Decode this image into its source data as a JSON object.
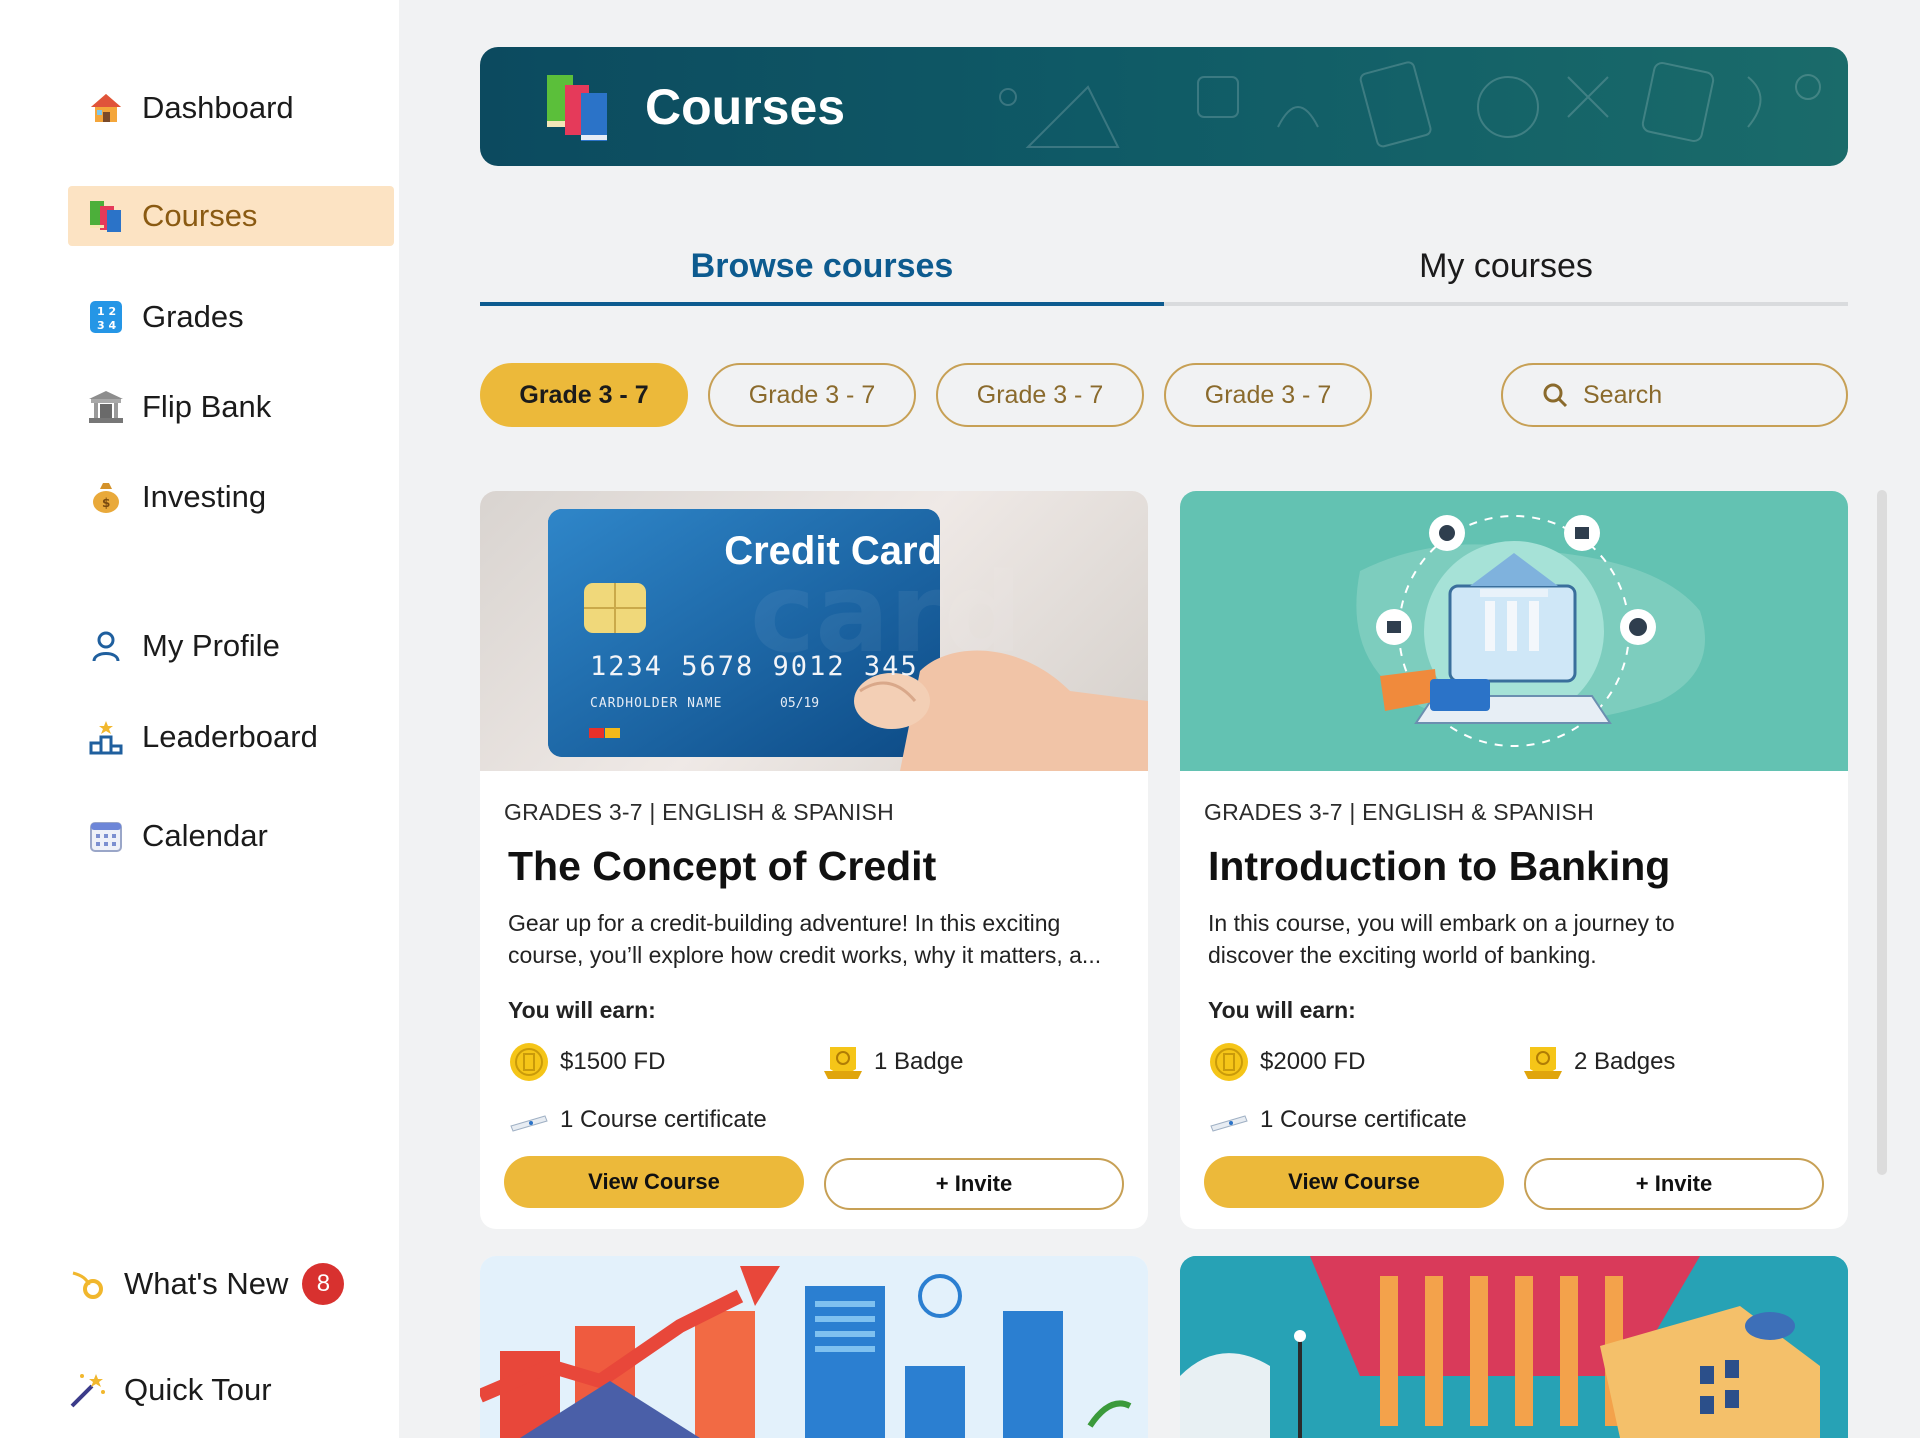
{
  "sidebar": {
    "items": [
      {
        "label": "Dashboard",
        "icon": "house-icon"
      },
      {
        "label": "Courses",
        "icon": "books-icon"
      },
      {
        "label": "Grades",
        "icon": "numbers-icon"
      },
      {
        "label": "Flip Bank",
        "icon": "bank-icon"
      },
      {
        "label": "Investing",
        "icon": "money-bag-icon"
      },
      {
        "label": "My Profile",
        "icon": "person-icon"
      },
      {
        "label": "Leaderboard",
        "icon": "podium-icon"
      },
      {
        "label": "Calendar",
        "icon": "calendar-icon"
      }
    ],
    "whats_new": {
      "label": "What's New",
      "count": "8"
    },
    "quick_tour": {
      "label": "Quick Tour"
    }
  },
  "header": {
    "title": "Courses"
  },
  "tabs": [
    {
      "label": "Browse courses",
      "active": true
    },
    {
      "label": "My courses",
      "active": false
    }
  ],
  "filters": [
    "Grade 3 - 7",
    "Grade 3 - 7",
    "Grade 3 - 7",
    "Grade 3 - 7"
  ],
  "search": {
    "placeholder": "Search"
  },
  "colors": {
    "accent": "#ecb93a",
    "primary": "#0d5b8f",
    "banner": "#0c4a5f",
    "active_nav": "#fce3c3"
  },
  "courses": [
    {
      "meta": "GRADES 3-7 | ENGLISH & SPANISH",
      "title": "The Concept of Credit",
      "description": "Gear up for a credit-building adventure! In this exciting course, you’ll explore how credit works, why it matters, a...",
      "earn_label": "You will earn:",
      "reward_money": "$1500 FD",
      "reward_badge": "1 Badge",
      "reward_certificate": "1 Course certificate",
      "view_label": "View Course",
      "invite_label": "+ Invite",
      "image": {
        "title": "Credit Card",
        "number": "1234 5678 9012 345",
        "holder": "CARDHOLDER NAME",
        "expiry": "05/19",
        "watermark": "card"
      }
    },
    {
      "meta": "GRADES 3-7 | ENGLISH & SPANISH",
      "title": "Introduction to Banking",
      "description": "In this course, you will embark on a journey to discover the exciting world of banking.",
      "earn_label": "You will earn:",
      "reward_money": "$2000 FD",
      "reward_badge": "2 Badges",
      "reward_certificate": "1 Course certificate",
      "view_label": "View Course",
      "invite_label": "+ Invite",
      "image": {}
    }
  ]
}
